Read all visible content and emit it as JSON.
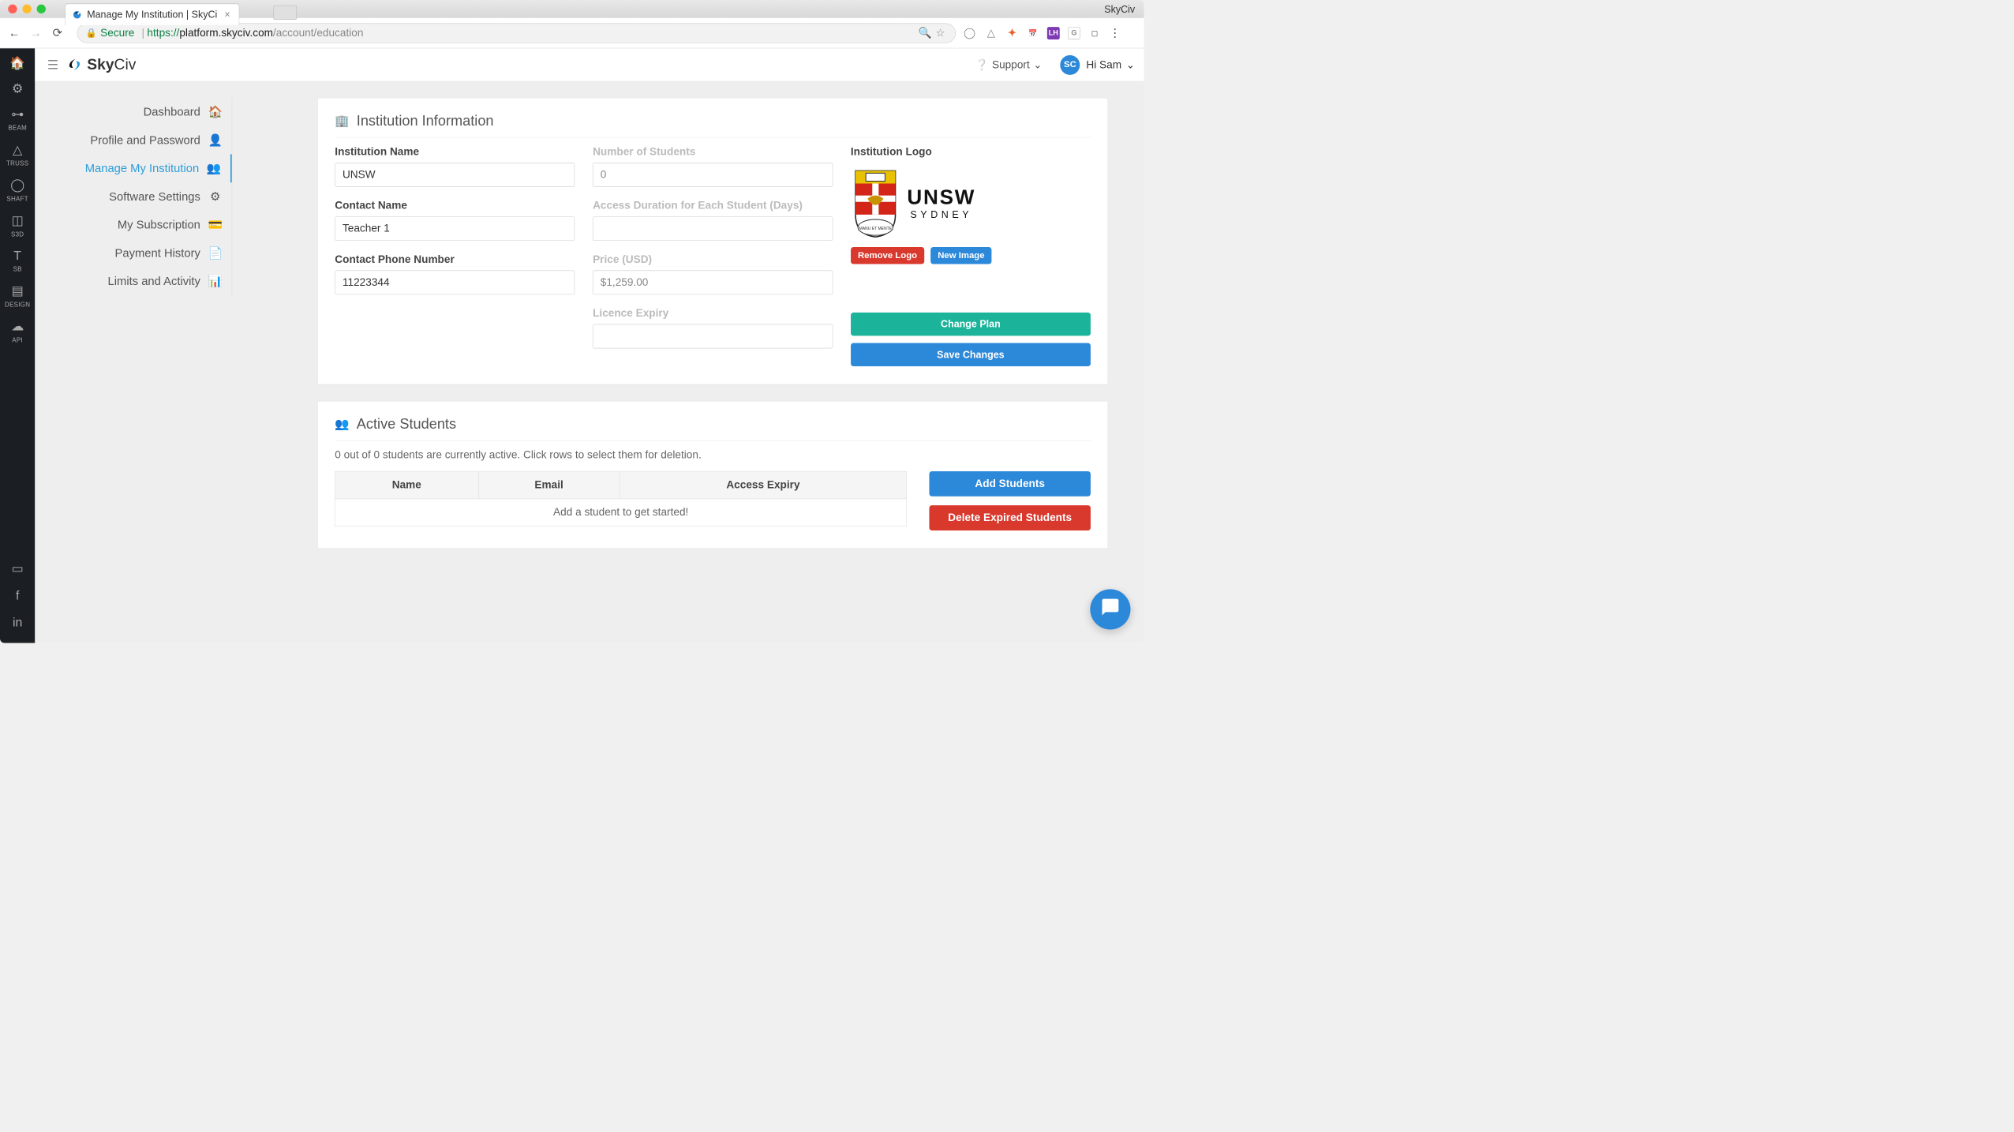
{
  "window": {
    "title": "Manage My Institution | SkyCi",
    "app_name": "SkyCiv"
  },
  "browser": {
    "secure_label": "Secure",
    "url_scheme": "https://",
    "url_host": "platform.skyciv.com",
    "url_path": "/account/education"
  },
  "header": {
    "logo_text_bold": "Sky",
    "logo_text_rest": "Civ",
    "support": "Support",
    "avatar_initials": "SC",
    "greeting": "Hi Sam"
  },
  "rail": {
    "items": [
      {
        "icon": "home",
        "label": ""
      },
      {
        "icon": "gear",
        "label": ""
      },
      {
        "icon": "beam",
        "label": "BEAM"
      },
      {
        "icon": "truss",
        "label": "TRUSS"
      },
      {
        "icon": "shaft",
        "label": "SHAFT"
      },
      {
        "icon": "s3d",
        "label": "S3D"
      },
      {
        "icon": "sb",
        "label": "SB"
      },
      {
        "icon": "design",
        "label": "DESIGN"
      },
      {
        "icon": "api",
        "label": "API"
      }
    ],
    "bottom": [
      "youtube",
      "facebook",
      "linkedin"
    ]
  },
  "sidemenu": {
    "items": [
      {
        "label": "Dashboard",
        "icon": "home"
      },
      {
        "label": "Profile and Password",
        "icon": "user"
      },
      {
        "label": "Manage My Institution",
        "icon": "users",
        "active": true
      },
      {
        "label": "Software Settings",
        "icon": "gear"
      },
      {
        "label": "My Subscription",
        "icon": "card"
      },
      {
        "label": "Payment History",
        "icon": "doc"
      },
      {
        "label": "Limits and Activity",
        "icon": "chart"
      }
    ]
  },
  "institution": {
    "panel_title": "Institution Information",
    "name_label": "Institution Name",
    "name_value": "UNSW",
    "contact_name_label": "Contact Name",
    "contact_name_value": "Teacher 1",
    "phone_label": "Contact Phone Number",
    "phone_value": "11223344",
    "num_students_label": "Number of Students",
    "num_students_value": "0",
    "access_dur_label": "Access Duration for Each Student (Days)",
    "access_dur_value": "",
    "price_label": "Price (USD)",
    "price_value": "$1,259.00",
    "expiry_label": "Licence Expiry",
    "expiry_value": "",
    "logo_label": "Institution Logo",
    "logo_name_line1": "UNSW",
    "logo_name_line2": "SYDNEY",
    "remove_logo": "Remove Logo",
    "new_image": "New Image",
    "change_plan": "Change Plan",
    "save_changes": "Save Changes"
  },
  "students": {
    "panel_title": "Active Students",
    "note": "0 out of 0 students are currently active. Click rows to select them for deletion.",
    "headers": {
      "name": "Name",
      "email": "Email",
      "expiry": "Access Expiry"
    },
    "empty_row": "Add a student to get started!",
    "add_btn": "Add Students",
    "delete_btn": "Delete Expired Students"
  }
}
